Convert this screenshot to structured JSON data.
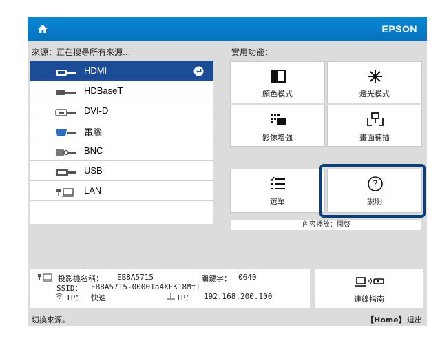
{
  "titlebar": {
    "brand": "EPSON"
  },
  "sources": {
    "heading": "來源：正在搜尋所有來源...",
    "items": [
      {
        "label": "HDMI",
        "icon": "hdmi-port-icon",
        "selected": true
      },
      {
        "label": "HDBaseT",
        "icon": "hdbaset-cable-icon",
        "selected": false
      },
      {
        "label": "DVI-D",
        "icon": "dvi-port-icon",
        "selected": false
      },
      {
        "label": "電腦",
        "icon": "computer-port-icon",
        "selected": false
      },
      {
        "label": "BNC",
        "icon": "bnc-connector-icon",
        "selected": false
      },
      {
        "label": "USB",
        "icon": "usb-port-icon",
        "selected": false
      },
      {
        "label": "LAN",
        "icon": "lan-icon",
        "selected": false
      }
    ]
  },
  "functions": {
    "heading": "實用功能：",
    "buttons": [
      {
        "label": "顏色模式",
        "icon": "color-mode-icon"
      },
      {
        "label": "燈光模式",
        "icon": "light-mode-icon"
      },
      {
        "label": "影像增強",
        "icon": "image-enhance-icon"
      },
      {
        "label": "畫面補插",
        "icon": "frame-interpolation-icon"
      }
    ],
    "menu_label": "選單",
    "help_label": "說明",
    "status_text": "內容播放：開啓"
  },
  "network_info": {
    "projector_name_label": "投影機名稱：",
    "projector_name": "EB8A5715",
    "keyword_label": "關鍵字：",
    "keyword": "0640",
    "ssid_label": "SSID：",
    "ssid": "EB8A5715-00001a4XFK18MtI",
    "wireless_ip_label": "IP：",
    "wireless_ip": "快速",
    "wired_ip_label": "IP：",
    "wired_ip": "192.168.200.100"
  },
  "connection_guide_label": "連線指南",
  "footer": {
    "hint": "切換來源。",
    "home_key": "【Home】",
    "home_action": "：退出"
  },
  "colors": {
    "titlebar": "#0a87d3",
    "selected": "#1b4c98",
    "highlight": "#0d3f7a"
  }
}
